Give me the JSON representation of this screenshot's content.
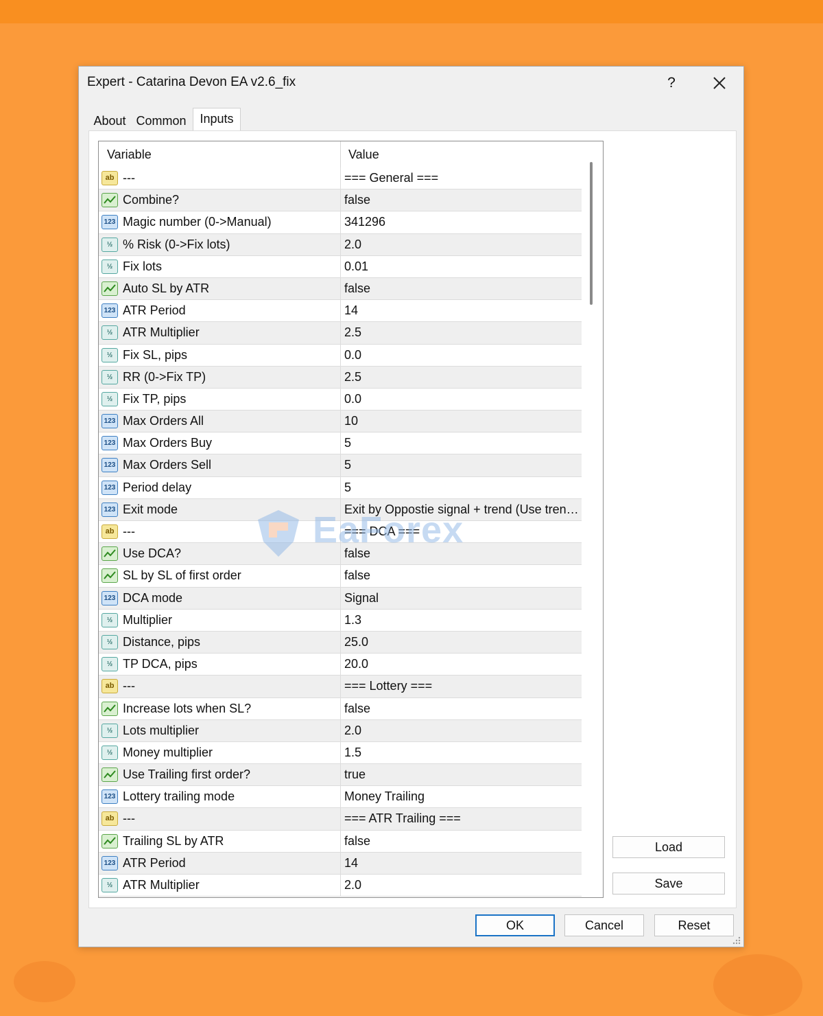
{
  "window": {
    "title": "Expert - Catarina Devon EA v2.6_fix",
    "help_label": "?"
  },
  "tabs": [
    {
      "label": "About",
      "active": false
    },
    {
      "label": "Common",
      "active": false
    },
    {
      "label": "Inputs",
      "active": true
    }
  ],
  "grid": {
    "columns": {
      "variable": "Variable",
      "value": "Value"
    },
    "rows": [
      {
        "type": "ab",
        "variable": "---",
        "value": "=== General ==="
      },
      {
        "type": "bool",
        "variable": "Combine?",
        "value": "false"
      },
      {
        "type": "int",
        "variable": "Magic number (0->Manual)",
        "value": "341296"
      },
      {
        "type": "dbl",
        "variable": "% Risk (0->Fix lots)",
        "value": "2.0"
      },
      {
        "type": "dbl",
        "variable": "Fix lots",
        "value": "0.01"
      },
      {
        "type": "bool",
        "variable": "Auto SL by ATR",
        "value": "false"
      },
      {
        "type": "int",
        "variable": "ATR Period",
        "value": "14"
      },
      {
        "type": "dbl",
        "variable": "ATR Multiplier",
        "value": "2.5"
      },
      {
        "type": "dbl",
        "variable": "Fix SL, pips",
        "value": "0.0"
      },
      {
        "type": "dbl",
        "variable": "RR (0->Fix TP)",
        "value": "2.5"
      },
      {
        "type": "dbl",
        "variable": "Fix TP, pips",
        "value": "0.0"
      },
      {
        "type": "int",
        "variable": "Max Orders All",
        "value": "10"
      },
      {
        "type": "int",
        "variable": "Max Orders Buy",
        "value": "5"
      },
      {
        "type": "int",
        "variable": "Max Orders Sell",
        "value": "5"
      },
      {
        "type": "int",
        "variable": "Period delay",
        "value": "5"
      },
      {
        "type": "int",
        "variable": "Exit mode",
        "value": "Exit by Oppostie signal + trend (Use trend i..."
      },
      {
        "type": "ab",
        "variable": "---",
        "value": "=== DCA ==="
      },
      {
        "type": "bool",
        "variable": "Use DCA?",
        "value": "false"
      },
      {
        "type": "bool",
        "variable": "SL by SL of first order",
        "value": "false"
      },
      {
        "type": "int",
        "variable": "DCA mode",
        "value": "Signal"
      },
      {
        "type": "dbl",
        "variable": "Multiplier",
        "value": "1.3"
      },
      {
        "type": "dbl",
        "variable": "Distance, pips",
        "value": "25.0"
      },
      {
        "type": "dbl",
        "variable": "TP DCA, pips",
        "value": "20.0"
      },
      {
        "type": "ab",
        "variable": "---",
        "value": "=== Lottery ==="
      },
      {
        "type": "bool",
        "variable": "Increase lots when SL?",
        "value": "false"
      },
      {
        "type": "dbl",
        "variable": "Lots multiplier",
        "value": "2.0"
      },
      {
        "type": "dbl",
        "variable": "Money multiplier",
        "value": "1.5"
      },
      {
        "type": "bool",
        "variable": "Use Trailing first order?",
        "value": "true"
      },
      {
        "type": "int",
        "variable": "Lottery trailing mode",
        "value": "Money Trailing"
      },
      {
        "type": "ab",
        "variable": "---",
        "value": "=== ATR Trailing ==="
      },
      {
        "type": "bool",
        "variable": "Trailing SL by ATR",
        "value": "false"
      },
      {
        "type": "int",
        "variable": "ATR Period",
        "value": "14"
      },
      {
        "type": "dbl",
        "variable": "ATR Multiplier",
        "value": "2.0"
      }
    ]
  },
  "icon_labels": {
    "ab": "ab",
    "int": "123",
    "dbl": "½"
  },
  "buttons": {
    "load": "Load",
    "save": "Save",
    "ok": "OK",
    "cancel": "Cancel",
    "reset": "Reset"
  },
  "watermark": {
    "text": "EaForex"
  },
  "colors": {
    "background": "#fb9a3a",
    "accent": "#1a73c6"
  }
}
